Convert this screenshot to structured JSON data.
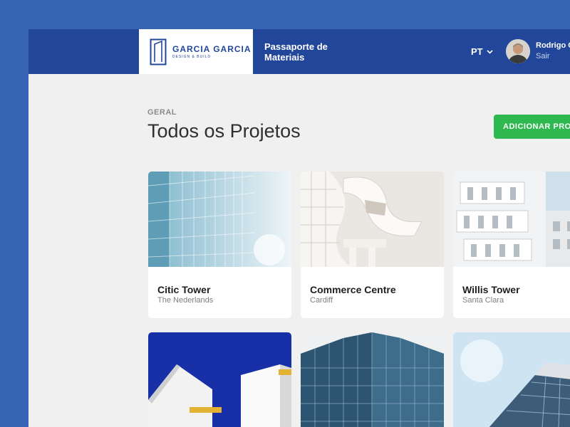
{
  "header": {
    "brand_name": "GARCIA GARCIA",
    "brand_tagline": "DESIGN & BUILD",
    "app_title": "Passaporte de Materiais",
    "language": "PT",
    "user_name": "Rodrigo C",
    "logout_label": "Sair"
  },
  "main": {
    "overline": "GERAL",
    "title": "Todos os Projetos",
    "add_button_label": "ADICIONAR PROJ"
  },
  "projects": [
    {
      "name": "Citic Tower",
      "location": "The Nederlands"
    },
    {
      "name": "Commerce Centre",
      "location": "Cardiff"
    },
    {
      "name": "Willis Tower",
      "location": "Santa Clara"
    },
    {
      "name": "",
      "location": ""
    },
    {
      "name": "",
      "location": ""
    },
    {
      "name": "",
      "location": ""
    }
  ],
  "colors": {
    "outer_background": "#3763b5",
    "topbar": "#22479a",
    "page_background": "#f0f0f0",
    "accent_green": "#2eb84f"
  },
  "icons": {
    "brand": "building-logo-icon",
    "language_dropdown": "chevron-down-icon"
  }
}
